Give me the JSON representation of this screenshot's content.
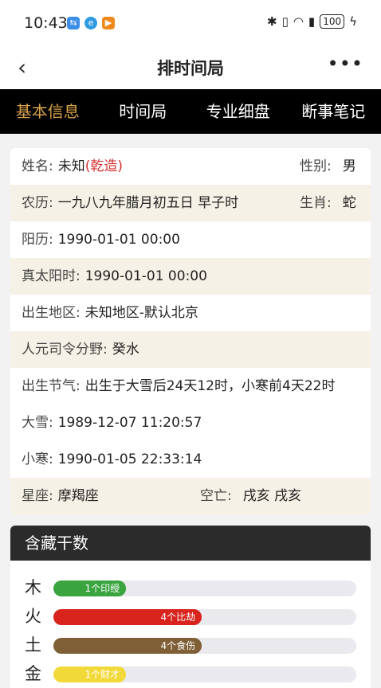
{
  "status": {
    "time": "10:43",
    "battery": "100"
  },
  "nav": {
    "title": "排时间局"
  },
  "tabs": [
    {
      "label": "基本信息",
      "active": true
    },
    {
      "label": "时间局",
      "active": false
    },
    {
      "label": "专业细盘",
      "active": false
    },
    {
      "label": "断事笔记",
      "active": false
    }
  ],
  "info": {
    "name_label": "姓名:",
    "name_value": "未知",
    "name_tag": "(乾造)",
    "gender_label": "性别:",
    "gender_value": "男",
    "lunar_label": "农历:",
    "lunar_value": "一九八九年腊月初五日 早子时",
    "zodiac_label": "生肖:",
    "zodiac_value": "蛇",
    "solar_label": "阳历:",
    "solar_value": "1990-01-01 00:00",
    "true_solar_label": "真太阳时:",
    "true_solar_value": "1990-01-01 00:00",
    "region_label": "出生地区:",
    "region_value": "未知地区-默认北京",
    "siling_label": "人元司令分野:",
    "siling_value": "癸水",
    "jieqi_label": "出生节气:",
    "jieqi_value": "出生于大雪后24天12时，小寒前4天22时",
    "daxue_label": "大雪:",
    "daxue_value": "1989-12-07 11:20:57",
    "xiaohan_label": "小寒:",
    "xiaohan_value": "1990-01-05 22:33:14",
    "star_label": "星座:",
    "star_value": "摩羯座",
    "kongwang_label": "空亡:",
    "kongwang_value": "戌亥 戌亥"
  },
  "hidden_stems": {
    "title": "含藏干数",
    "rows": [
      {
        "element": "木",
        "label": "1个印绶",
        "fraction": 0.24,
        "color": "#3aa53f"
      },
      {
        "element": "火",
        "label": "4个比劫",
        "fraction": 0.49,
        "color": "#d9231d"
      },
      {
        "element": "土",
        "label": "4个食伤",
        "fraction": 0.49,
        "color": "#7f5f36"
      },
      {
        "element": "金",
        "label": "1个财才",
        "fraction": 0.24,
        "color": "#f2d93a"
      }
    ]
  }
}
